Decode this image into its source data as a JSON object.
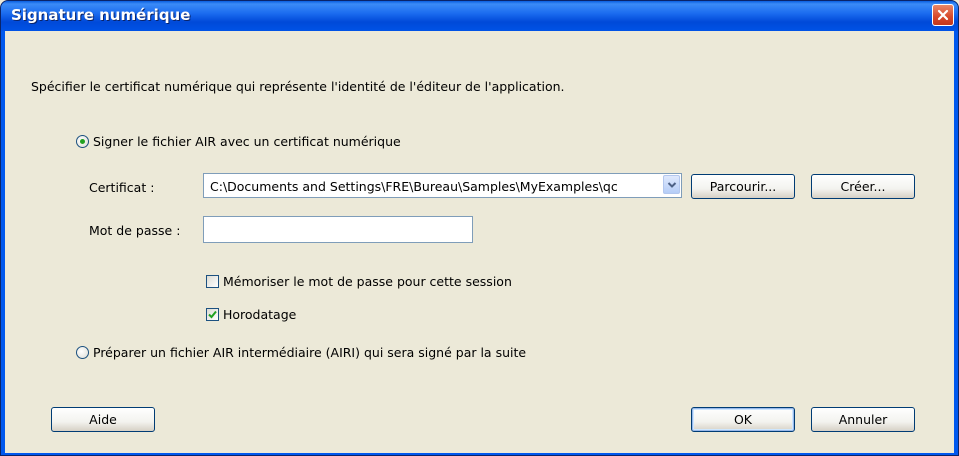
{
  "window": {
    "title": "Signature numérique"
  },
  "dialog": {
    "description": "Spécifier le certificat numérique qui représente l'identité de l'éditeur de l'application.",
    "option_sign": {
      "label": "Signer le fichier AIR avec un certificat numérique",
      "selected": true
    },
    "certificate": {
      "label": "Certificat :",
      "value": "C:\\Documents and Settings\\FRE\\Bureau\\Samples\\MyExamples\\qc"
    },
    "browse_label": "Parcourir...",
    "create_label": "Créer...",
    "password": {
      "label": "Mot de passe :",
      "value": ""
    },
    "remember_password": {
      "label": "Mémoriser le mot de passe pour cette session",
      "checked": false
    },
    "timestamp": {
      "label": "Horodatage",
      "checked": true
    },
    "option_prepare": {
      "label": "Préparer un fichier AIR intermédiaire (AIRI) qui sera signé par la suite",
      "selected": false
    }
  },
  "footer": {
    "help_label": "Aide",
    "ok_label": "OK",
    "cancel_label": "Annuler"
  },
  "colors": {
    "titlebar": "#0058ee",
    "dialog_background": "#ece9d8",
    "radio_check_accent": "#21a121",
    "close_button": "#d7482a"
  },
  "icons": {
    "close": "close-icon",
    "dropdown": "chevron-down-icon",
    "check": "check-icon"
  }
}
